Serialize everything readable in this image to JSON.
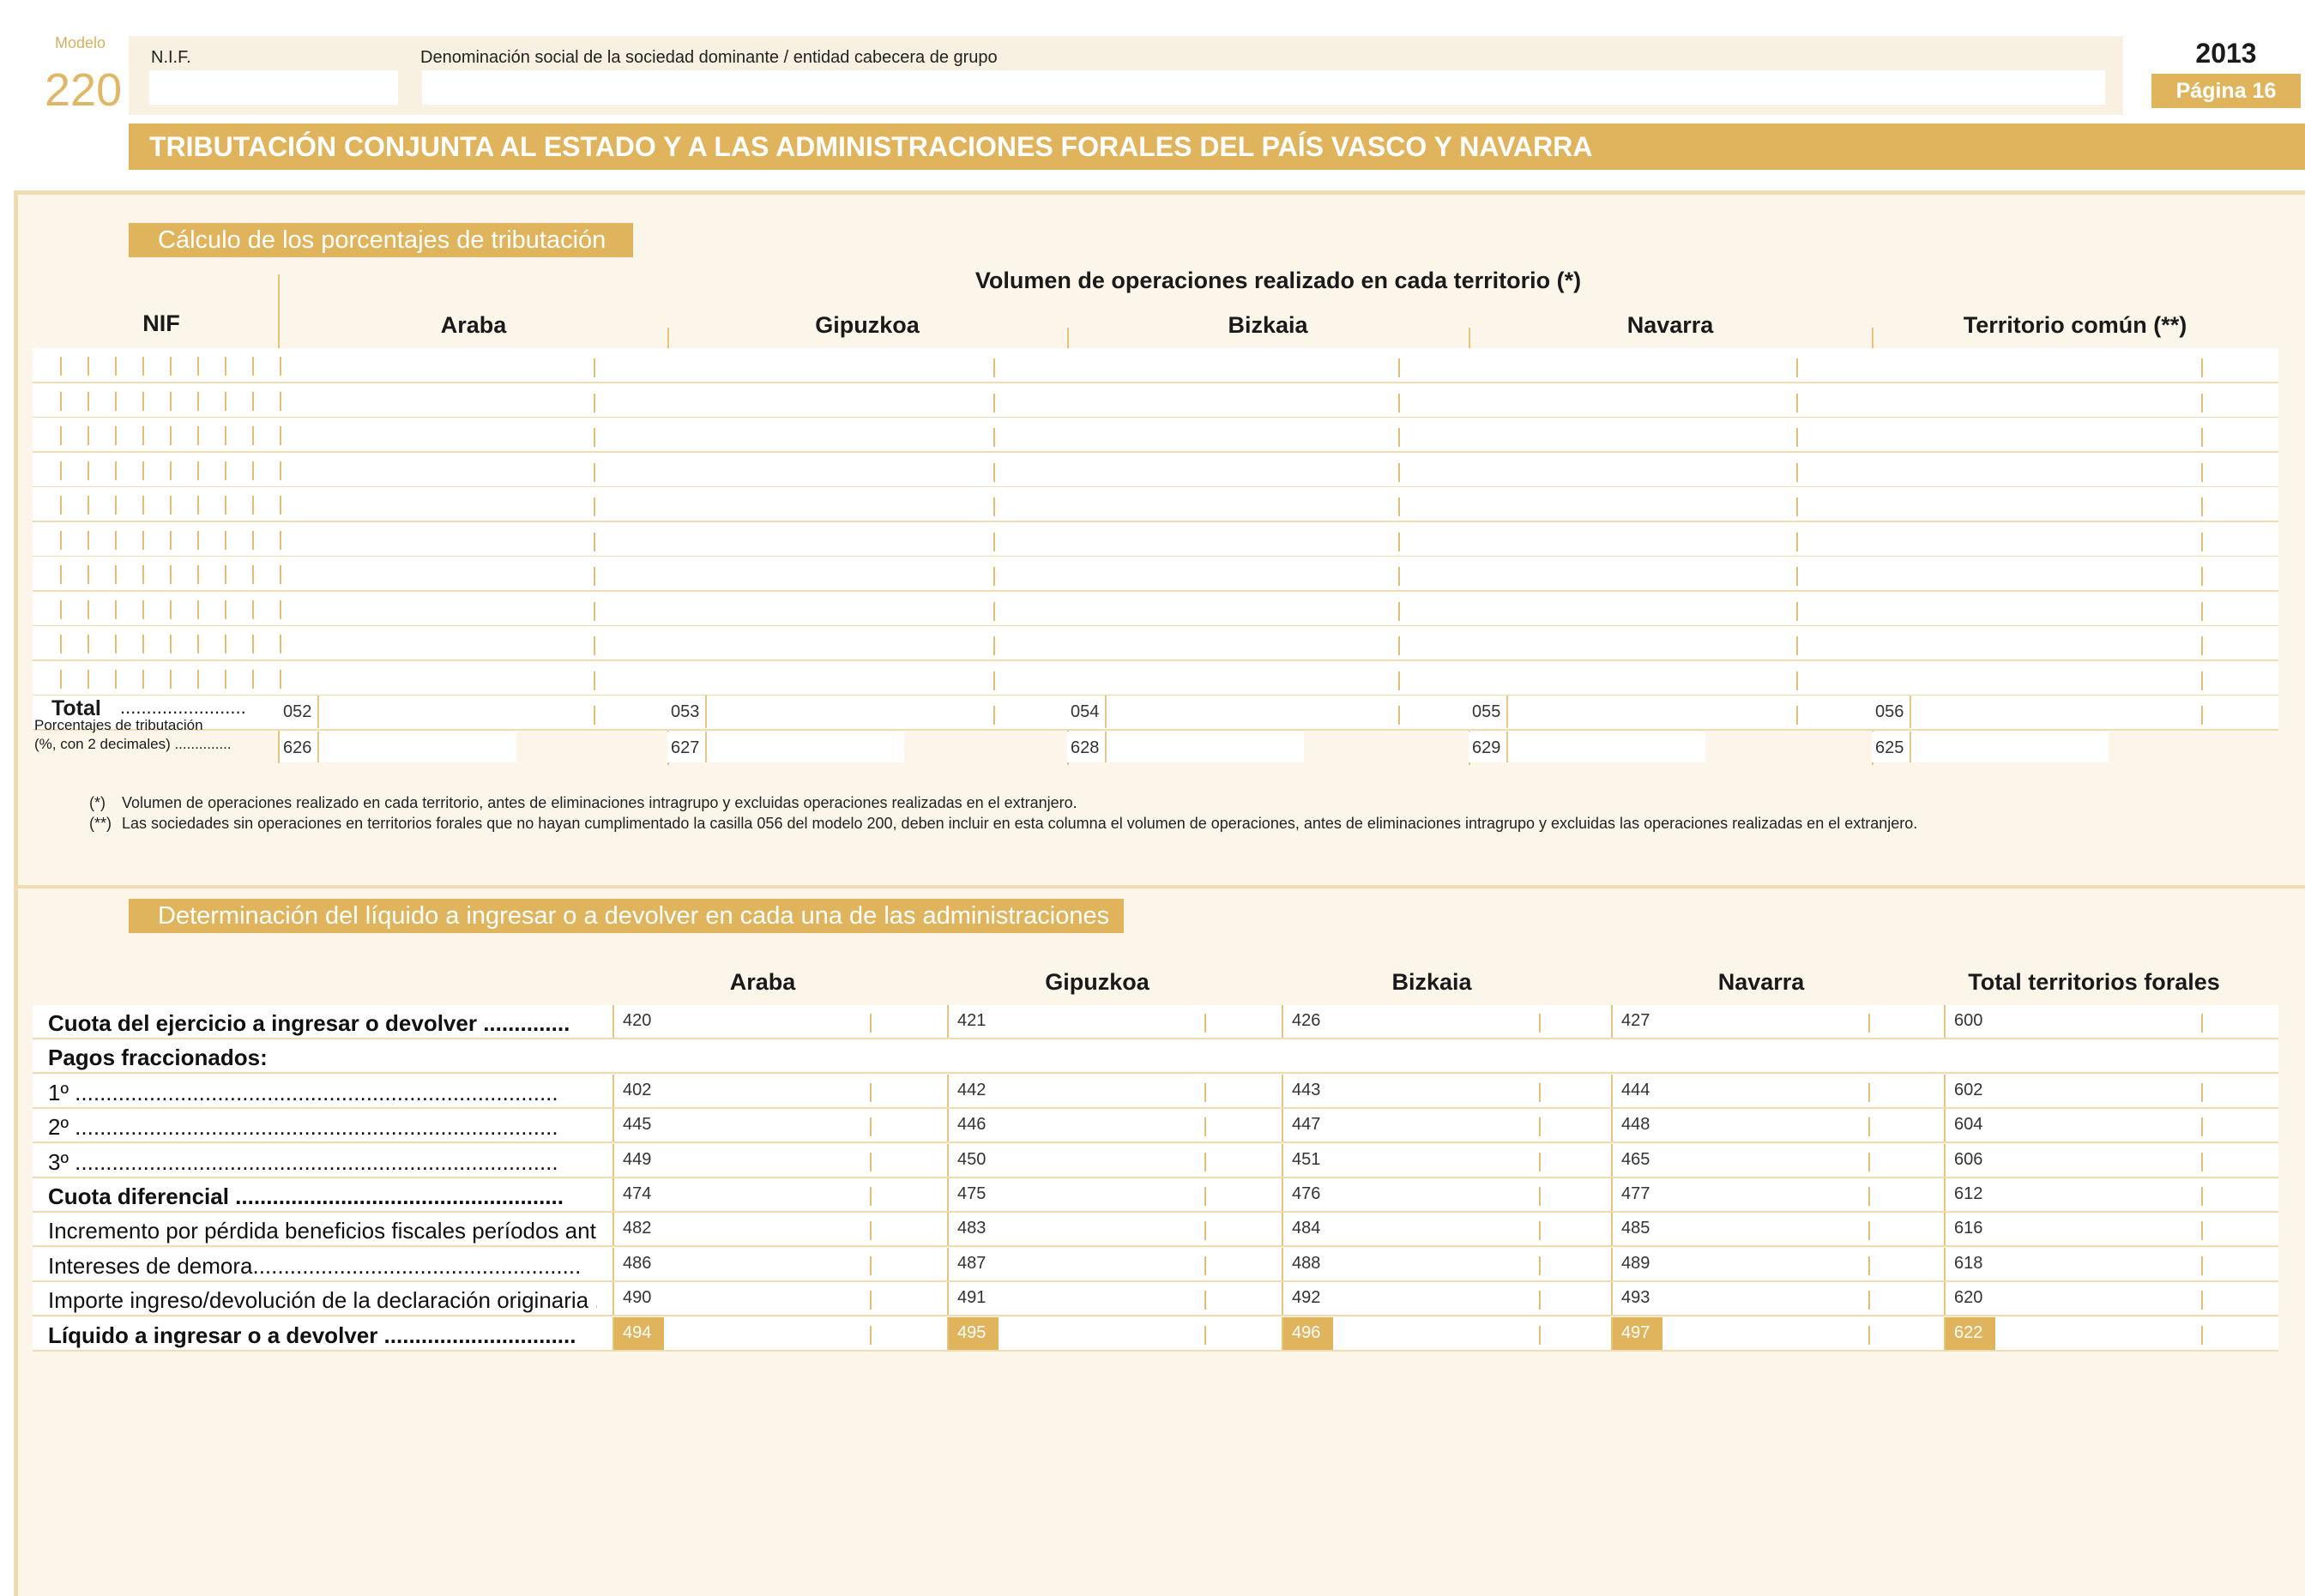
{
  "header": {
    "modelo_label": "Modelo",
    "modelo_num": "220",
    "nif_label": "N.I.F.",
    "denominacion_label": "Denominación social de la sociedad dominante / entidad cabecera de grupo",
    "year": "2013",
    "page": "Página 16",
    "main_title": "TRIBUTACIÓN CONJUNTA AL ESTADO Y A LAS ADMINISTRACIONES FORALES DEL PAÍS VASCO Y NAVARRA"
  },
  "section1": {
    "title": "Cálculo de los porcentajes de tributación",
    "volumen_header": "Volumen de operaciones realizado en cada territorio (*)",
    "nif_header": "NIF",
    "columns": [
      "Araba",
      "Gipuzkoa",
      "Bizkaia",
      "Navarra",
      "Territorio común (**)"
    ],
    "total_label": "Total",
    "total_dots": "........................",
    "pct_label_1": "Porcentajes de tributación",
    "pct_label_2": "(%, con 2 decimales) ..............",
    "total_codes": [
      "052",
      "053",
      "054",
      "055",
      "056"
    ],
    "pct_codes": [
      "626",
      "627",
      "628",
      "629",
      "625"
    ],
    "note1_mark": "(*)",
    "note1": "Volumen de operaciones realizado en cada territorio, antes de eliminaciones intragrupo y excluidas operaciones realizadas en el extranjero.",
    "note2_mark": "(**)",
    "note2": "Las sociedades sin operaciones en territorios forales que no hayan cumplimentado la casilla 056 del modelo 200, deben incluir en esta columna el volumen de operaciones, antes de eliminaciones intragrupo y excluidas las operaciones realizadas en el extranjero."
  },
  "section2": {
    "title": "Determinación del líquido a ingresar o a devolver en cada una de las administraciones",
    "columns": [
      "Araba",
      "Gipuzkoa",
      "Bizkaia",
      "Navarra",
      "Total territorios forales"
    ],
    "rows": [
      {
        "label": "Cuota del ejercicio a ingresar o devolver ..............",
        "bold": true,
        "codes": [
          "420",
          "421",
          "426",
          "427",
          "600"
        ]
      },
      {
        "label": "Pagos fraccionados:",
        "bold": true,
        "codes": []
      },
      {
        "label": "1º ..............................................................................",
        "bold": false,
        "codes": [
          "402",
          "442",
          "443",
          "444",
          "602"
        ]
      },
      {
        "label": "2º ..............................................................................",
        "bold": false,
        "codes": [
          "445",
          "446",
          "447",
          "448",
          "604"
        ]
      },
      {
        "label": "3º ..............................................................................",
        "bold": false,
        "codes": [
          "449",
          "450",
          "451",
          "465",
          "606"
        ]
      },
      {
        "label": "Cuota diferencial .....................................................",
        "bold": true,
        "codes": [
          "474",
          "475",
          "476",
          "477",
          "612"
        ]
      },
      {
        "label": "Incremento por pérdida beneficios fiscales períodos anteriores..",
        "bold": false,
        "codes": [
          "482",
          "483",
          "484",
          "485",
          "616"
        ]
      },
      {
        "label": "Intereses de demora.....................................................",
        "bold": false,
        "codes": [
          "486",
          "487",
          "488",
          "489",
          "618"
        ]
      },
      {
        "label": "Importe ingreso/devolución de la declaración originaria ..",
        "bold": false,
        "codes": [
          "490",
          "491",
          "492",
          "493",
          "620"
        ]
      },
      {
        "label": "Líquido a ingresar o a devolver ...............................",
        "bold": true,
        "highlight": true,
        "codes": [
          "494",
          "495",
          "496",
          "497",
          "622"
        ]
      }
    ]
  }
}
